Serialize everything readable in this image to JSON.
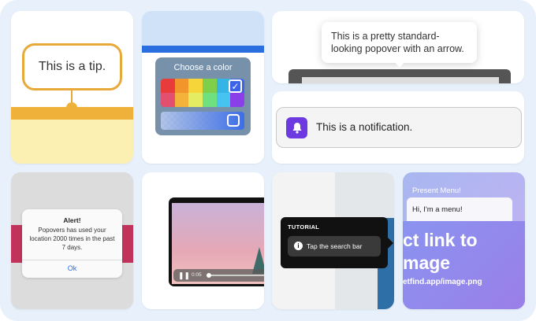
{
  "tip": {
    "text": "This is a tip."
  },
  "color_picker": {
    "title": "Choose a color",
    "swatches": [
      "#e83b3b",
      "#f2962b",
      "#f6d53a",
      "#7fcf4a",
      "#33b6e6",
      "#3d63e8",
      "#e34f6e",
      "#f4b23a",
      "#e4ec62",
      "#6ee07f",
      "#45c4f2",
      "#8a3fe8"
    ],
    "selected_mark": "✓"
  },
  "popover": {
    "text": "This is a pretty standard-looking popover with an arrow."
  },
  "notification": {
    "text": "This is a notification.",
    "icon": "bell-icon",
    "accent": "#6c3ae0"
  },
  "alert": {
    "title": "Alert!",
    "message": "Popovers has used your location 2000 times in the past 7 days.",
    "button": "Ok"
  },
  "video": {
    "time": "0:05",
    "icon": "pause-icon"
  },
  "tutorial": {
    "title": "TUTORIAL",
    "step": "Tap the search bar",
    "icon": "info-icon"
  },
  "present_menu": {
    "caption": "Present Menu!",
    "menu_item": "Hi, I'm a menu!",
    "background_text": "ct link to\nmage",
    "background_url": "etfind.app/image.png"
  }
}
